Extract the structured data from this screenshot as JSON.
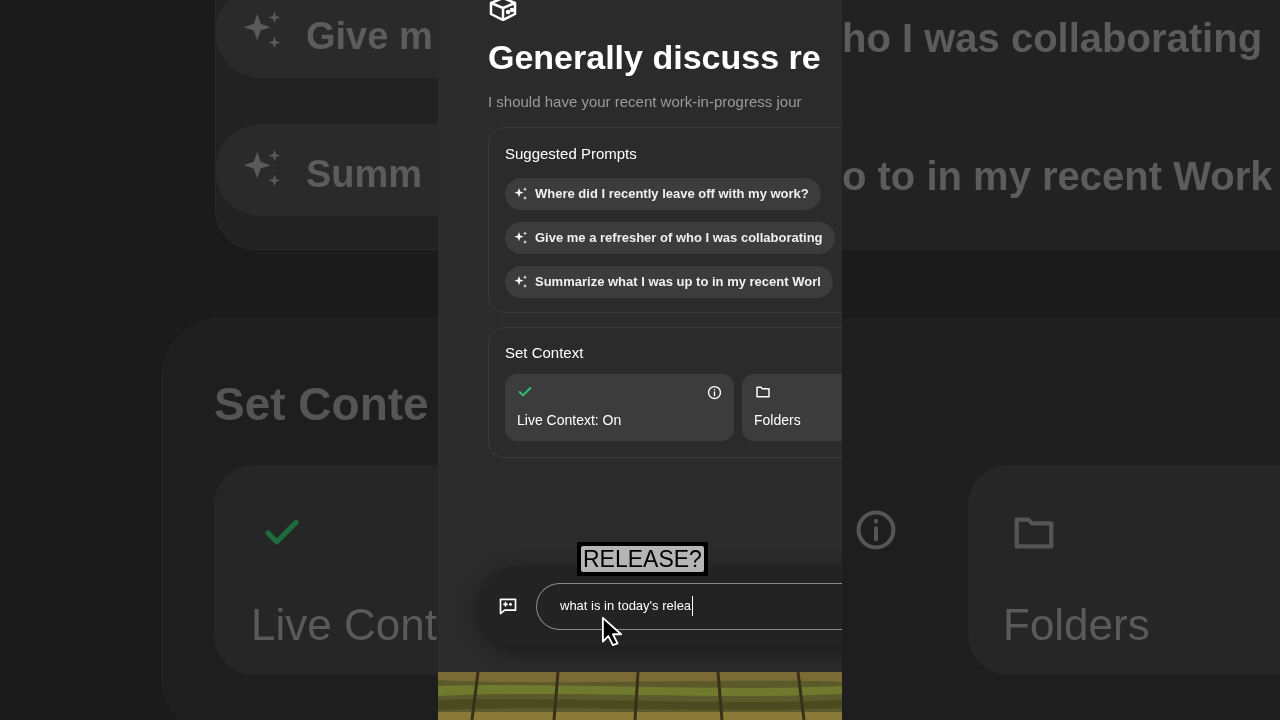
{
  "backdrop_left": {
    "prompts": [
      "Give m",
      "Summ"
    ],
    "section_title": "Set Conte",
    "card_label": "Live Cont",
    "card_checked": true
  },
  "backdrop_right": {
    "prompts": [
      "ho I was collaborating",
      "o to in my recent Work"
    ],
    "card_label": "Folders"
  },
  "header": {
    "title": "Generally discuss re",
    "subtitle": "I should have your recent work-in-progress jour"
  },
  "suggested_prompts": {
    "title": "Suggested Prompts",
    "items": [
      "Where did I recently leave off with my work?",
      "Give me a refresher of who I was collaborating",
      "Summarize what I was up to in my recent Worl"
    ]
  },
  "set_context": {
    "title": "Set Context",
    "cards": [
      {
        "kind": "toggle",
        "label": "Live Context: On",
        "checked": true
      },
      {
        "kind": "folder",
        "label": "Folders"
      }
    ]
  },
  "caption": "RELEASE?",
  "input": {
    "value": "what is in today's relea"
  }
}
